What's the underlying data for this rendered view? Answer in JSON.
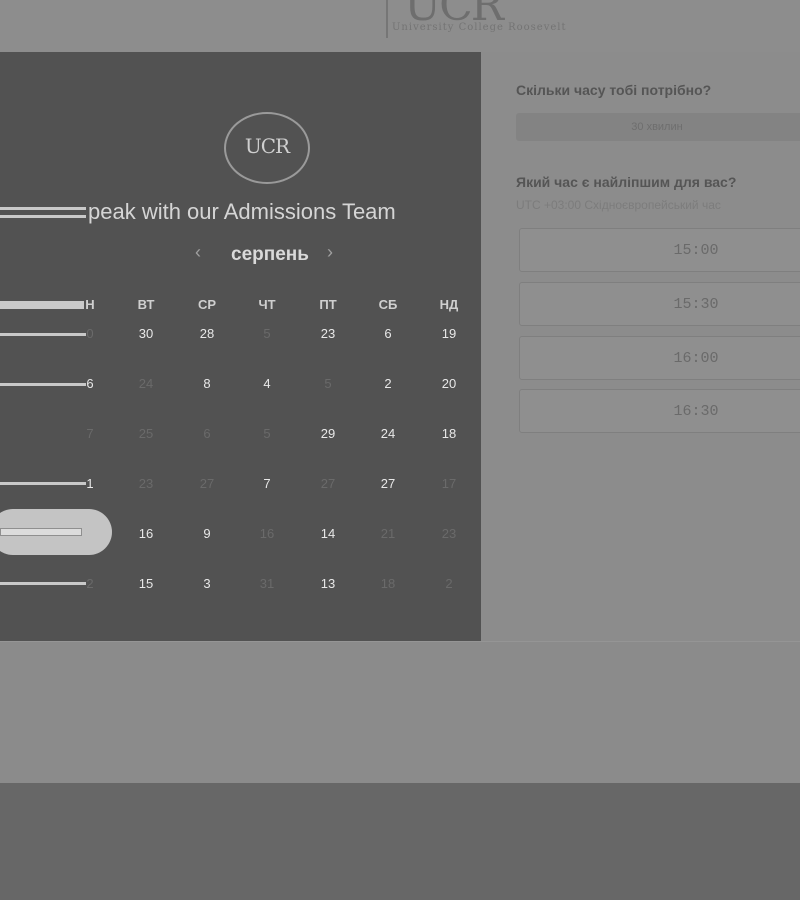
{
  "header": {
    "logo_text": "UCR",
    "logo_subtitle": "University College Roosevelt"
  },
  "panel": {
    "badge_text": "UCR",
    "title": "peak with our Admissions Team",
    "month": "серпень",
    "prev_icon": "‹",
    "next_icon": "›",
    "weekdays": [
      "Н",
      "ВТ",
      "СР",
      "ЧТ",
      "ПТ",
      "СБ",
      "НД"
    ],
    "rows": [
      [
        "0",
        "30",
        "28",
        "5",
        "23",
        "6",
        "19"
      ],
      [
        "6",
        "24",
        "8",
        "4",
        "5",
        "2",
        "20"
      ],
      [
        "7",
        "25",
        "6",
        "5",
        "29",
        "24",
        "18"
      ],
      [
        "1",
        "23",
        "27",
        "7",
        "27",
        "27",
        "17"
      ],
      [
        "",
        "16",
        "9",
        "16",
        "14",
        "21",
        "23"
      ],
      [
        "2",
        "15",
        "3",
        "31",
        "13",
        "18",
        "2"
      ]
    ]
  },
  "booking": {
    "duration_question": "Скільки часу тобі потрібно?",
    "duration_value": "30 хвилин",
    "time_question": "Який час є найліпшим для вас?",
    "timezone": "UTC +03:00 Східноєвропейський час",
    "slots": [
      "15:00",
      "15:30",
      "16:00",
      "16:30"
    ]
  }
}
